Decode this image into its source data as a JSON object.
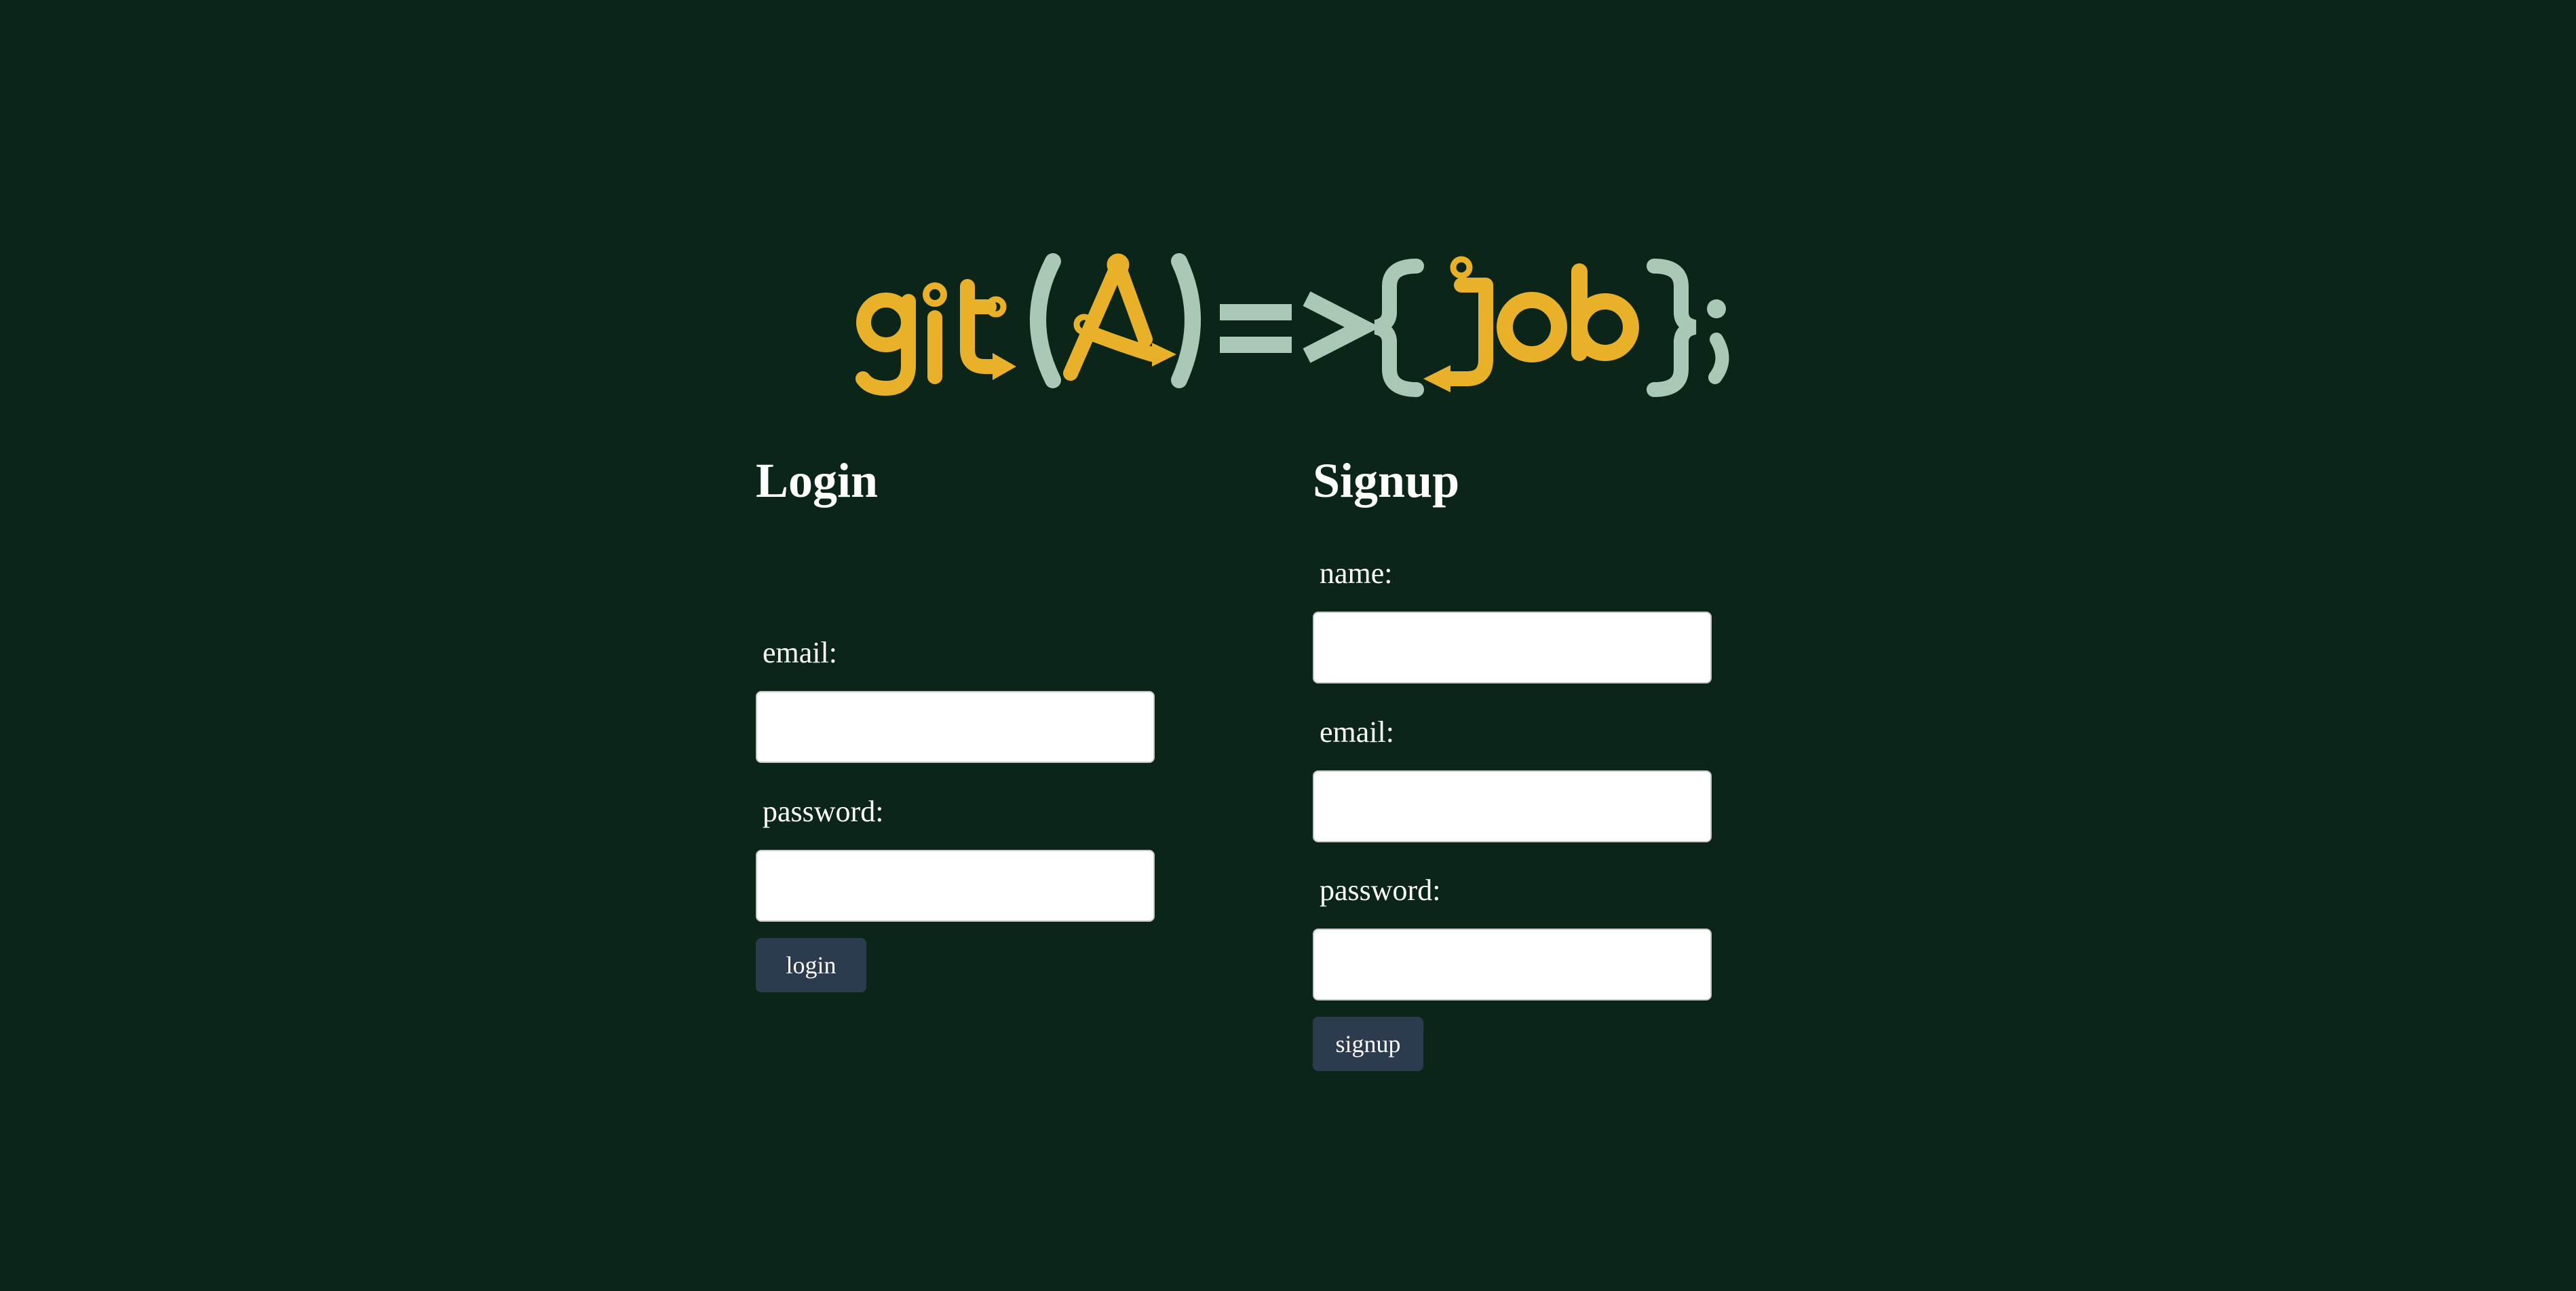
{
  "logo": {
    "text": "git(A)=>{Job};",
    "colors": {
      "accent": "#e9b12a",
      "soft": "#a9c9b6"
    }
  },
  "colors": {
    "background": "#0b2519",
    "button": "#2d3b4f",
    "input": "#ffffff"
  },
  "login": {
    "title": "Login",
    "email_label": "email:",
    "password_label": "password:",
    "button_label": "login"
  },
  "signup": {
    "title": "Signup",
    "name_label": "name:",
    "email_label": "email:",
    "password_label": "password:",
    "button_label": "signup"
  }
}
